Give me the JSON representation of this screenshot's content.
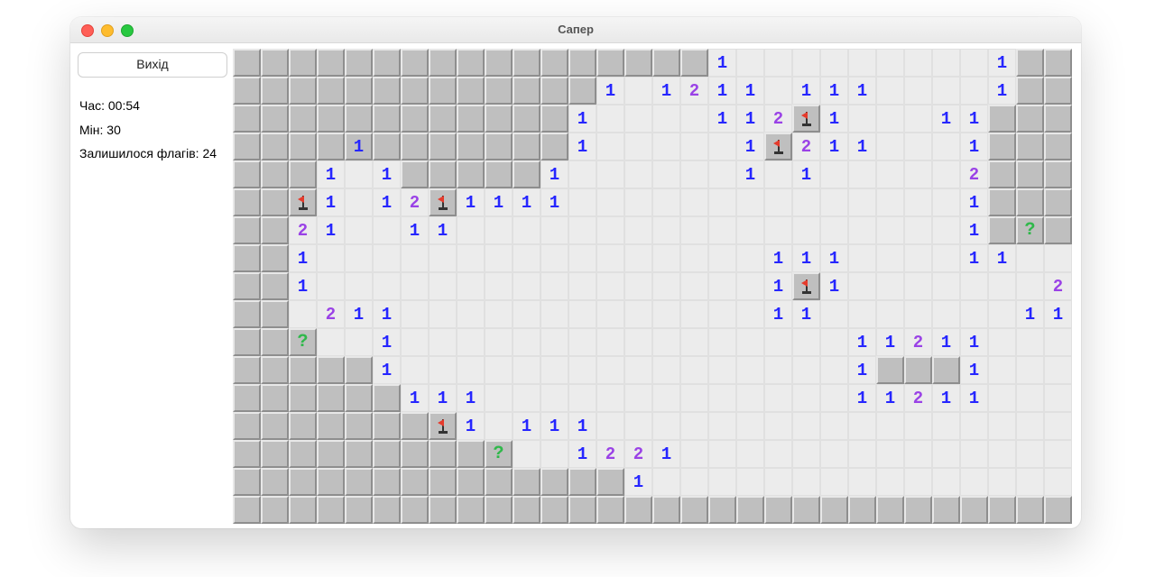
{
  "window": {
    "title": "Сапер"
  },
  "sidebar": {
    "exit_label": "Вихід",
    "time_label": "Час: 00:54",
    "mines_label": "Мін: 30",
    "flags_label": "Залишилося флагів: 24"
  },
  "board": {
    "cols": 30,
    "rows": 17,
    "cells": [
      [
        "C",
        "C",
        "C",
        "C",
        "C",
        "C",
        "C",
        "C",
        "C",
        "C",
        "C",
        "C",
        "C",
        "C",
        "C",
        "C",
        "C",
        "1",
        "",
        "",
        "",
        "",
        "",
        "",
        "",
        "",
        "",
        "1",
        "C",
        "C"
      ],
      [
        "C",
        "C",
        "C",
        "C",
        "C",
        "C",
        "C",
        "C",
        "C",
        "C",
        "C",
        "C",
        "C",
        "1",
        "",
        "1",
        "2",
        "1",
        "1",
        "",
        "1",
        "1",
        "1",
        "",
        "",
        "",
        "",
        "1",
        "C",
        "C"
      ],
      [
        "C",
        "C",
        "C",
        "C",
        "C",
        "C",
        "C",
        "C",
        "C",
        "C",
        "C",
        "C",
        "1",
        "",
        "",
        "",
        "",
        "1",
        "1",
        "2",
        "F",
        "1",
        "",
        "",
        "",
        "1",
        "1",
        "C",
        "C",
        "C"
      ],
      [
        "C",
        "C",
        "C",
        "C",
        "4_1",
        "C",
        "C",
        "C",
        "C",
        "C",
        "C",
        "C",
        "1",
        "",
        "",
        "",
        "",
        "",
        "1",
        "F",
        "2",
        "1",
        "1",
        "",
        "",
        "",
        "1",
        "C",
        "C",
        "C"
      ],
      [
        "C",
        "C",
        "C",
        "1",
        "",
        "1",
        "C",
        "C",
        "C",
        "C",
        "C",
        "1",
        "",
        "",
        "",
        "",
        "",
        "",
        "1",
        "",
        "1",
        "",
        "",
        "",
        "",
        "",
        "2",
        "C",
        "C",
        "C"
      ],
      [
        "C",
        "C",
        "F",
        "1",
        "",
        "1",
        "2",
        "F",
        "1",
        "1",
        "1",
        "1",
        "",
        "",
        "",
        "",
        "",
        "",
        "",
        "",
        "",
        "",
        "",
        "",
        "",
        "",
        "1",
        "C",
        "C",
        "C"
      ],
      [
        "C",
        "C",
        "2",
        "1",
        "",
        "",
        "1",
        "1",
        "",
        "",
        "",
        "",
        "",
        "",
        "",
        "",
        "",
        "",
        "",
        "",
        "",
        "",
        "",
        "",
        "",
        "",
        "1",
        "C",
        "?",
        "C"
      ],
      [
        "C",
        "C",
        "1",
        "",
        "",
        "",
        "",
        "",
        "",
        "",
        "",
        "",
        "",
        "",
        "",
        "",
        "",
        "",
        "",
        "1",
        "1",
        "1",
        "",
        "",
        "",
        "",
        "1",
        "1",
        "",
        ""
      ],
      [
        "C",
        "C",
        "1",
        "",
        "",
        "",
        "",
        "",
        "",
        "",
        "",
        "",
        "",
        "",
        "",
        "",
        "",
        "",
        "",
        "1",
        "F",
        "1",
        "",
        "",
        "",
        "",
        "",
        "",
        "",
        "2"
      ],
      [
        "C",
        "C",
        "",
        "2",
        "1",
        "1",
        "",
        "",
        "",
        "",
        "",
        "",
        "",
        "",
        "",
        "",
        "",
        "",
        "",
        "1",
        "1",
        "",
        "",
        "",
        "",
        "",
        "",
        "",
        "1",
        "1"
      ],
      [
        "C",
        "C",
        "?",
        "",
        "",
        "1",
        "",
        "",
        "",
        "",
        "",
        "",
        "",
        "",
        "",
        "",
        "",
        "",
        "",
        "",
        "",
        "",
        "1",
        "1",
        "2",
        "1",
        "1",
        "",
        "",
        ""
      ],
      [
        "C",
        "C",
        "C",
        "C",
        "C",
        "1",
        "",
        "",
        "",
        "",
        "",
        "",
        "",
        "",
        "",
        "",
        "",
        "",
        "",
        "",
        "",
        "",
        "1",
        "C",
        "C",
        "C",
        "1",
        "",
        "",
        ""
      ],
      [
        "C",
        "C",
        "C",
        "C",
        "C",
        "C",
        "1",
        "1",
        "1",
        "",
        "",
        "",
        "",
        "",
        "",
        "",
        "",
        "",
        "",
        "",
        "",
        "",
        "1",
        "1",
        "2",
        "1",
        "1",
        "",
        "",
        ""
      ],
      [
        "C",
        "C",
        "C",
        "C",
        "C",
        "C",
        "C",
        "F",
        "1",
        "",
        "1",
        "1",
        "1",
        "",
        "",
        "",
        "",
        "",
        "",
        "",
        "",
        "",
        "",
        "",
        "",
        "",
        "",
        "",
        "",
        ""
      ],
      [
        "C",
        "C",
        "C",
        "C",
        "C",
        "C",
        "C",
        "C",
        "C",
        "?",
        "",
        "",
        "1",
        "2",
        "2",
        "1",
        "",
        "",
        "",
        "",
        "",
        "",
        "",
        "",
        "",
        "",
        "",
        "",
        "",
        ""
      ],
      [
        "C",
        "C",
        "C",
        "C",
        "C",
        "C",
        "C",
        "C",
        "C",
        "C",
        "C",
        "C",
        "C",
        "C",
        "1",
        "",
        "",
        "",
        "",
        "",
        "",
        "",
        "",
        "",
        "",
        "",
        "",
        "",
        "",
        ""
      ],
      [
        "C",
        "C",
        "C",
        "C",
        "C",
        "C",
        "C",
        "C",
        "C",
        "C",
        "C",
        "C",
        "C",
        "C",
        "C",
        "C",
        "C",
        "C",
        "C",
        "C",
        "C",
        "C",
        "C",
        "C",
        "C",
        "C",
        "C",
        "C",
        "C",
        "C"
      ]
    ]
  }
}
